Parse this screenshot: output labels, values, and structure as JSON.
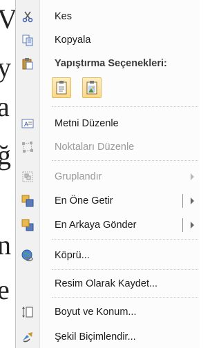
{
  "background": {
    "peek_letters": [
      "V",
      "y",
      "a",
      "ğ",
      "n",
      "e"
    ]
  },
  "menu": {
    "items": [
      {
        "label": "Kes",
        "icon": "scissors-icon",
        "enabled": true
      },
      {
        "label": "Kopyala",
        "icon": "copy-icon",
        "enabled": true
      },
      {
        "label": "Yapıştırma Seçenekleri:",
        "icon": "paste-icon",
        "enabled": true,
        "header": true
      },
      {
        "label": "Metni Düzenle",
        "icon": "edit-text-icon",
        "enabled": true
      },
      {
        "label": "Noktaları Düzenle",
        "icon": "edit-points-icon",
        "enabled": false
      },
      {
        "label": "Gruplandır",
        "icon": "group-icon",
        "enabled": false,
        "submenu": true
      },
      {
        "label": "En Öne Getir",
        "icon": "bring-to-front-icon",
        "enabled": true,
        "submenu": true
      },
      {
        "label": "En Arkaya Gönder",
        "icon": "send-to-back-icon",
        "enabled": true,
        "submenu": true
      },
      {
        "label": "Köprü...",
        "icon": "hyperlink-icon",
        "enabled": true
      },
      {
        "label": "Resim Olarak Kaydet...",
        "icon": "",
        "enabled": true
      },
      {
        "label": "Boyut ve Konum...",
        "icon": "size-position-icon",
        "enabled": true
      },
      {
        "label": "Şekil Biçimlendir...",
        "icon": "format-shape-icon",
        "enabled": true
      }
    ],
    "paste_options": [
      "keep-text-only-icon",
      "paste-as-picture-icon"
    ]
  }
}
